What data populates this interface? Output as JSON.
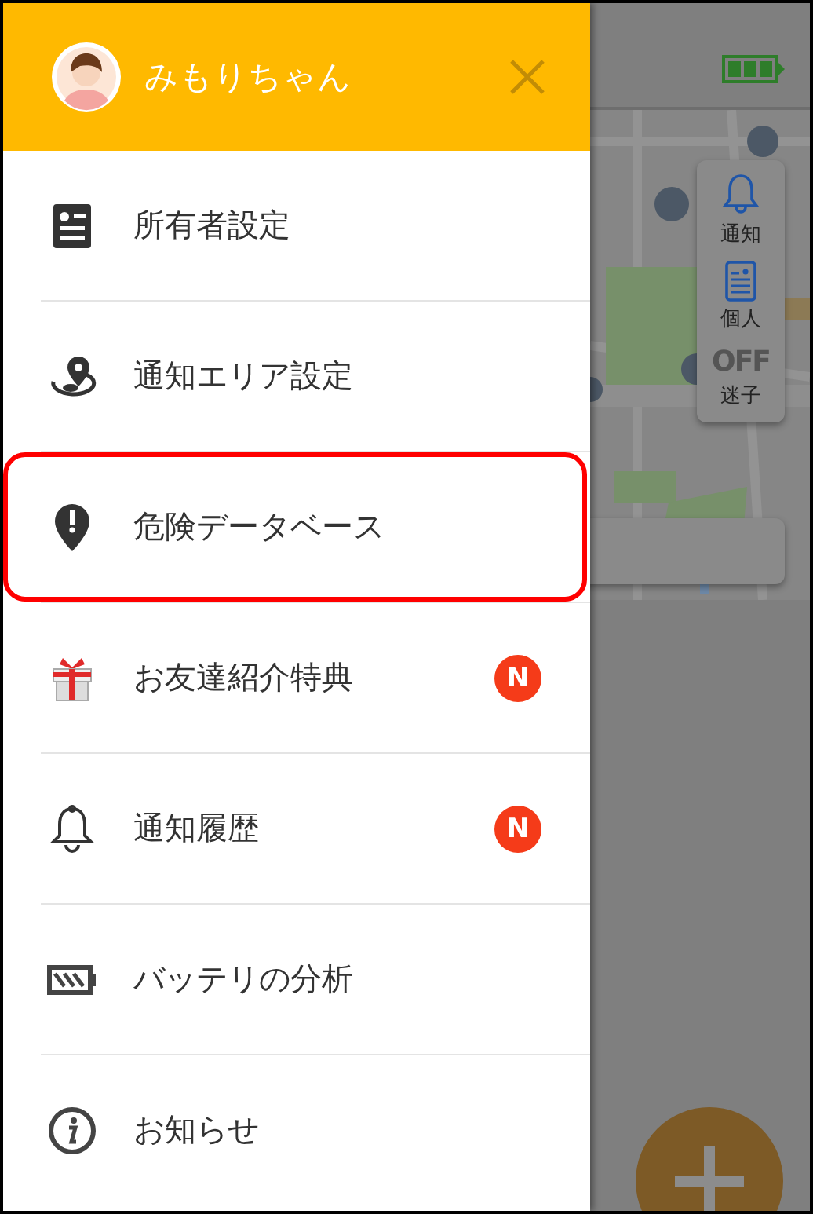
{
  "drawer": {
    "user_name": "みもりちゃん",
    "items": [
      {
        "kind": "owner",
        "label": "所有者設定",
        "highlighted": false
      },
      {
        "kind": "area",
        "label": "通知エリア設定",
        "highlighted": false
      },
      {
        "kind": "danger",
        "label": "危険データベース",
        "highlighted": true
      },
      {
        "kind": "gift",
        "label": "お友達紹介特典",
        "highlighted": false,
        "badge": "N"
      },
      {
        "kind": "bell",
        "label": "通知履歴",
        "highlighted": false,
        "badge": "N"
      },
      {
        "kind": "battery",
        "label": "バッテリの分析",
        "highlighted": false
      },
      {
        "kind": "info",
        "label": "お知らせ",
        "highlighted": false
      }
    ]
  },
  "map_panel": {
    "buttons": [
      {
        "kind": "bell",
        "label": "通知"
      },
      {
        "kind": "profile",
        "label": "個人"
      },
      {
        "kind": "off",
        "icon_text": "OFF",
        "label": "迷子"
      }
    ]
  }
}
